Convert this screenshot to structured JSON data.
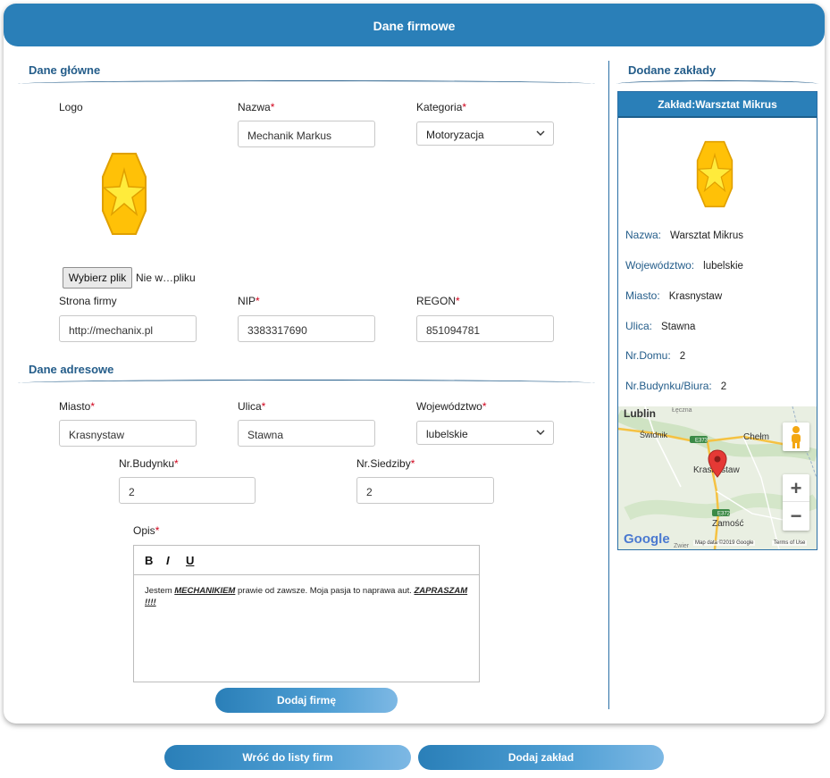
{
  "header": {
    "title": "Dane firmowe"
  },
  "main_section": {
    "title": "Dane główne",
    "logo_label": "Logo",
    "name": {
      "label": "Nazwa",
      "value": "Mechanik Markus"
    },
    "category": {
      "label": "Kategoria",
      "value": "Motoryzacja"
    },
    "file": {
      "button": "Wybierz plik",
      "status": "Nie w…pliku"
    },
    "website": {
      "label": "Strona firmy",
      "value": "http://mechanix.pl"
    },
    "nip": {
      "label": "NIP",
      "value": "3383317690"
    },
    "regon": {
      "label": "REGON",
      "value": "851094781"
    }
  },
  "address_section": {
    "title": "Dane adresowe",
    "city": {
      "label": "Miasto",
      "value": "Krasnystaw"
    },
    "street": {
      "label": "Ulica",
      "value": "Stawna"
    },
    "voivodeship": {
      "label": "Województwo",
      "value": "lubelskie"
    },
    "building_no": {
      "label": "Nr.Budynku",
      "value": "2"
    },
    "office_no": {
      "label": "Nr.Siedziby",
      "value": "2"
    },
    "description": {
      "label": "Opis",
      "toolbar": {
        "bold": "B",
        "italic": "I",
        "underline": "U"
      },
      "text_before": "Jestem ",
      "text_bold1": "MECHANIKIEM",
      "text_middle": " prawie od zawsze. Moja pasja to naprawa aut. ",
      "text_bold2": "ZAPRASZAM !!!!"
    },
    "submit": "Dodaj firmę"
  },
  "branches": {
    "title": "Dodane zakłady",
    "card": {
      "heading": "Zakład:Warsztat Mikrus",
      "fields": [
        {
          "label": "Nazwa:",
          "value": "Warsztat Mikrus"
        },
        {
          "label": "Województwo:",
          "value": "lubelskie"
        },
        {
          "label": "Miasto:",
          "value": "Krasnystaw"
        },
        {
          "label": "Ulica:",
          "value": "Stawna"
        },
        {
          "label": "Nr.Domu:",
          "value": "2"
        },
        {
          "label": "Nr.Budynku/Biura:",
          "value": "2"
        }
      ],
      "map": {
        "places": [
          "Lublin",
          "Świdnik",
          "Chełm",
          "Krasnystaw",
          "Zamość",
          "Łęczna",
          "Zwier"
        ],
        "roads": [
          "E373",
          "E372"
        ],
        "logo": "Google",
        "attribution": "Map data ©2019 Google",
        "terms": "Terms of Use",
        "zoom_in": "+",
        "zoom_out": "−",
        "colors": {
          "pin": "#e53935",
          "road": "#f5c242"
        }
      }
    }
  },
  "footer": {
    "back": "Wróć do listy firm",
    "add_branch": "Dodaj zakład"
  },
  "colors": {
    "accent": "#2a7fb8",
    "required": "#d0021b",
    "logo_fill": "#ffc107"
  }
}
